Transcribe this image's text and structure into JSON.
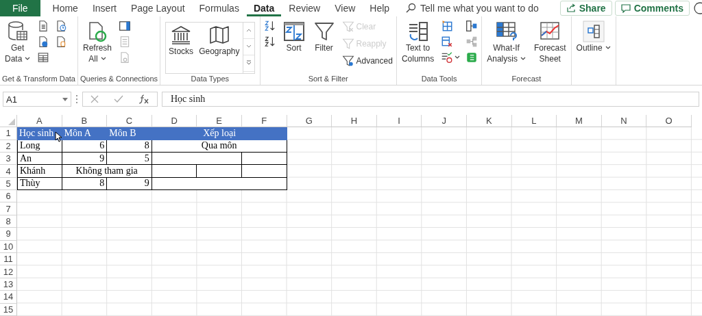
{
  "tabs": [
    {
      "label": "File",
      "kind": "file",
      "selected": false
    },
    {
      "label": "Home",
      "kind": "tab",
      "selected": false
    },
    {
      "label": "Insert",
      "kind": "tab",
      "selected": false
    },
    {
      "label": "Page Layout",
      "kind": "tab",
      "selected": false
    },
    {
      "label": "Formulas",
      "kind": "tab",
      "selected": false
    },
    {
      "label": "Data",
      "kind": "tab",
      "selected": true
    },
    {
      "label": "Review",
      "kind": "tab",
      "selected": false
    },
    {
      "label": "View",
      "kind": "tab",
      "selected": false
    },
    {
      "label": "Help",
      "kind": "tab",
      "selected": false
    }
  ],
  "search": {
    "placeholder": "Tell me what you want to do"
  },
  "actions": [
    {
      "label": "Share"
    },
    {
      "label": "Comments"
    }
  ],
  "ribbon": {
    "groups": [
      {
        "label": "Get & Transform Data",
        "kind": "plain",
        "columns": [
          [
            {
              "kind": "large",
              "lines": [
                "Get",
                "Data"
              ],
              "caret": true,
              "disabled": false
            }
          ],
          [
            {
              "kind": "icon",
              "disabled": false
            },
            {
              "kind": "icon",
              "disabled": false
            },
            {
              "kind": "icon",
              "disabled": false
            }
          ],
          [
            {
              "kind": "icon",
              "disabled": false
            },
            {
              "kind": "icon",
              "disabled": false
            }
          ]
        ]
      },
      {
        "label": "Queries & Connections",
        "kind": "plain",
        "columns": [
          [
            {
              "kind": "large",
              "lines": [
                "Refresh",
                "All"
              ],
              "caret": true,
              "disabled": false
            }
          ],
          [
            {
              "kind": "icon",
              "disabled": false
            },
            {
              "kind": "icon",
              "disabled": true
            },
            {
              "kind": "icon",
              "disabled": true
            }
          ]
        ]
      },
      {
        "label": "Data Types",
        "kind": "gallery",
        "columns": [
          [
            {
              "kind": "large",
              "lines": [
                "Stocks"
              ],
              "caret": false,
              "disabled": false
            }
          ],
          [
            {
              "kind": "large",
              "lines": [
                "Geography"
              ],
              "caret": false,
              "disabled": false
            }
          ],
          [
            {
              "kind": "scroll",
              "disabled": false
            }
          ]
        ]
      },
      {
        "label": "Sort & Filter",
        "kind": "plain",
        "columns": [
          [
            {
              "kind": "icon",
              "disabled": false
            },
            {
              "kind": "icon",
              "disabled": false
            }
          ],
          [
            {
              "kind": "large",
              "lines": [
                "Sort"
              ],
              "caret": false,
              "disabled": false
            }
          ],
          [
            {
              "kind": "large",
              "lines": [
                "Filter"
              ],
              "caret": false,
              "disabled": false
            }
          ],
          [
            {
              "kind": "small",
              "label": "Clear",
              "disabled": true
            },
            {
              "kind": "small",
              "label": "Reapply",
              "disabled": true
            },
            {
              "kind": "small",
              "label": "Advanced",
              "disabled": false
            }
          ]
        ]
      },
      {
        "label": "Data Tools",
        "kind": "plain",
        "columns": [
          [
            {
              "kind": "large",
              "lines": [
                "Text to",
                "Columns"
              ],
              "caret": false,
              "disabled": false
            }
          ],
          [
            {
              "kind": "icon",
              "caret": false,
              "disabled": false
            },
            {
              "kind": "icon",
              "caret": false,
              "disabled": false
            },
            {
              "kind": "icon",
              "caret": true,
              "disabled": false
            }
          ],
          [
            {
              "kind": "icon",
              "caret": false,
              "disabled": false
            },
            {
              "kind": "icon",
              "caret": false,
              "disabled": false
            },
            {
              "kind": "icon",
              "caret": false,
              "disabled": false
            }
          ]
        ]
      },
      {
        "label": "Forecast",
        "kind": "plain",
        "columns": [
          [
            {
              "kind": "large",
              "lines": [
                "What-If",
                "Analysis"
              ],
              "caret": true,
              "disabled": false
            }
          ],
          [
            {
              "kind": "large",
              "lines": [
                "Forecast",
                "Sheet"
              ],
              "caret": false,
              "disabled": false
            }
          ]
        ]
      },
      {
        "kind": "plain",
        "columns": [
          [
            {
              "kind": "large",
              "lines": [
                "Outline"
              ],
              "caret": true,
              "disabled": false
            }
          ]
        ]
      }
    ]
  },
  "formula_bar": {
    "name_box": "A1",
    "formula": "Học sinh"
  },
  "sheet": {
    "columns": [
      "A",
      "B",
      "C",
      "D",
      "E",
      "F",
      "G",
      "H",
      "I",
      "J",
      "K",
      "L",
      "M",
      "N",
      "O"
    ],
    "rows": [
      {
        "label": "1",
        "cells": [
          {
            "text": "Học sinh",
            "kind": "label",
            "header": true
          },
          {
            "text": "Môn A",
            "kind": "label",
            "header": true
          },
          {
            "text": "Môn B",
            "kind": "label",
            "header": true
          },
          {
            "text": "Xếp loại",
            "kind": "merge3",
            "header": true
          }
        ]
      },
      {
        "label": "2",
        "cells": [
          {
            "text": "Long",
            "kind": "label",
            "header": false
          },
          {
            "text": "6",
            "kind": "number",
            "header": false
          },
          {
            "text": "8",
            "kind": "number",
            "header": false
          },
          {
            "text": "Qua môn",
            "kind": "merge3",
            "header": false
          }
        ]
      },
      {
        "label": "3",
        "cells": [
          {
            "text": "An",
            "kind": "label",
            "header": false
          },
          {
            "text": "9",
            "kind": "number",
            "header": false
          },
          {
            "text": "5",
            "kind": "number",
            "header": false
          },
          {
            "kind": "merge2",
            "header": false
          },
          {
            "kind": "label",
            "header": false
          }
        ]
      },
      {
        "label": "4",
        "cells": [
          {
            "text": "Khánh",
            "kind": "label",
            "header": false
          },
          {
            "text": "Không tham gia",
            "kind": "merge2",
            "header": false
          },
          {
            "kind": "label",
            "header": false
          },
          {
            "kind": "label",
            "header": false
          },
          {
            "kind": "label",
            "header": false
          }
        ]
      },
      {
        "label": "5",
        "cells": [
          {
            "text": "Thùy",
            "kind": "label",
            "header": false
          },
          {
            "text": "8",
            "kind": "number",
            "header": false
          },
          {
            "text": "9",
            "kind": "number",
            "header": false
          },
          {
            "kind": "merge3",
            "header": false
          }
        ]
      },
      {
        "label": "6",
        "cells": []
      },
      {
        "label": "7",
        "cells": []
      },
      {
        "label": "8",
        "cells": []
      },
      {
        "label": "9",
        "cells": []
      },
      {
        "label": "10",
        "cells": []
      },
      {
        "label": "11",
        "cells": []
      },
      {
        "label": "12",
        "cells": []
      },
      {
        "label": "13",
        "cells": []
      },
      {
        "label": "14",
        "cells": []
      },
      {
        "label": "15",
        "cells": []
      }
    ]
  }
}
